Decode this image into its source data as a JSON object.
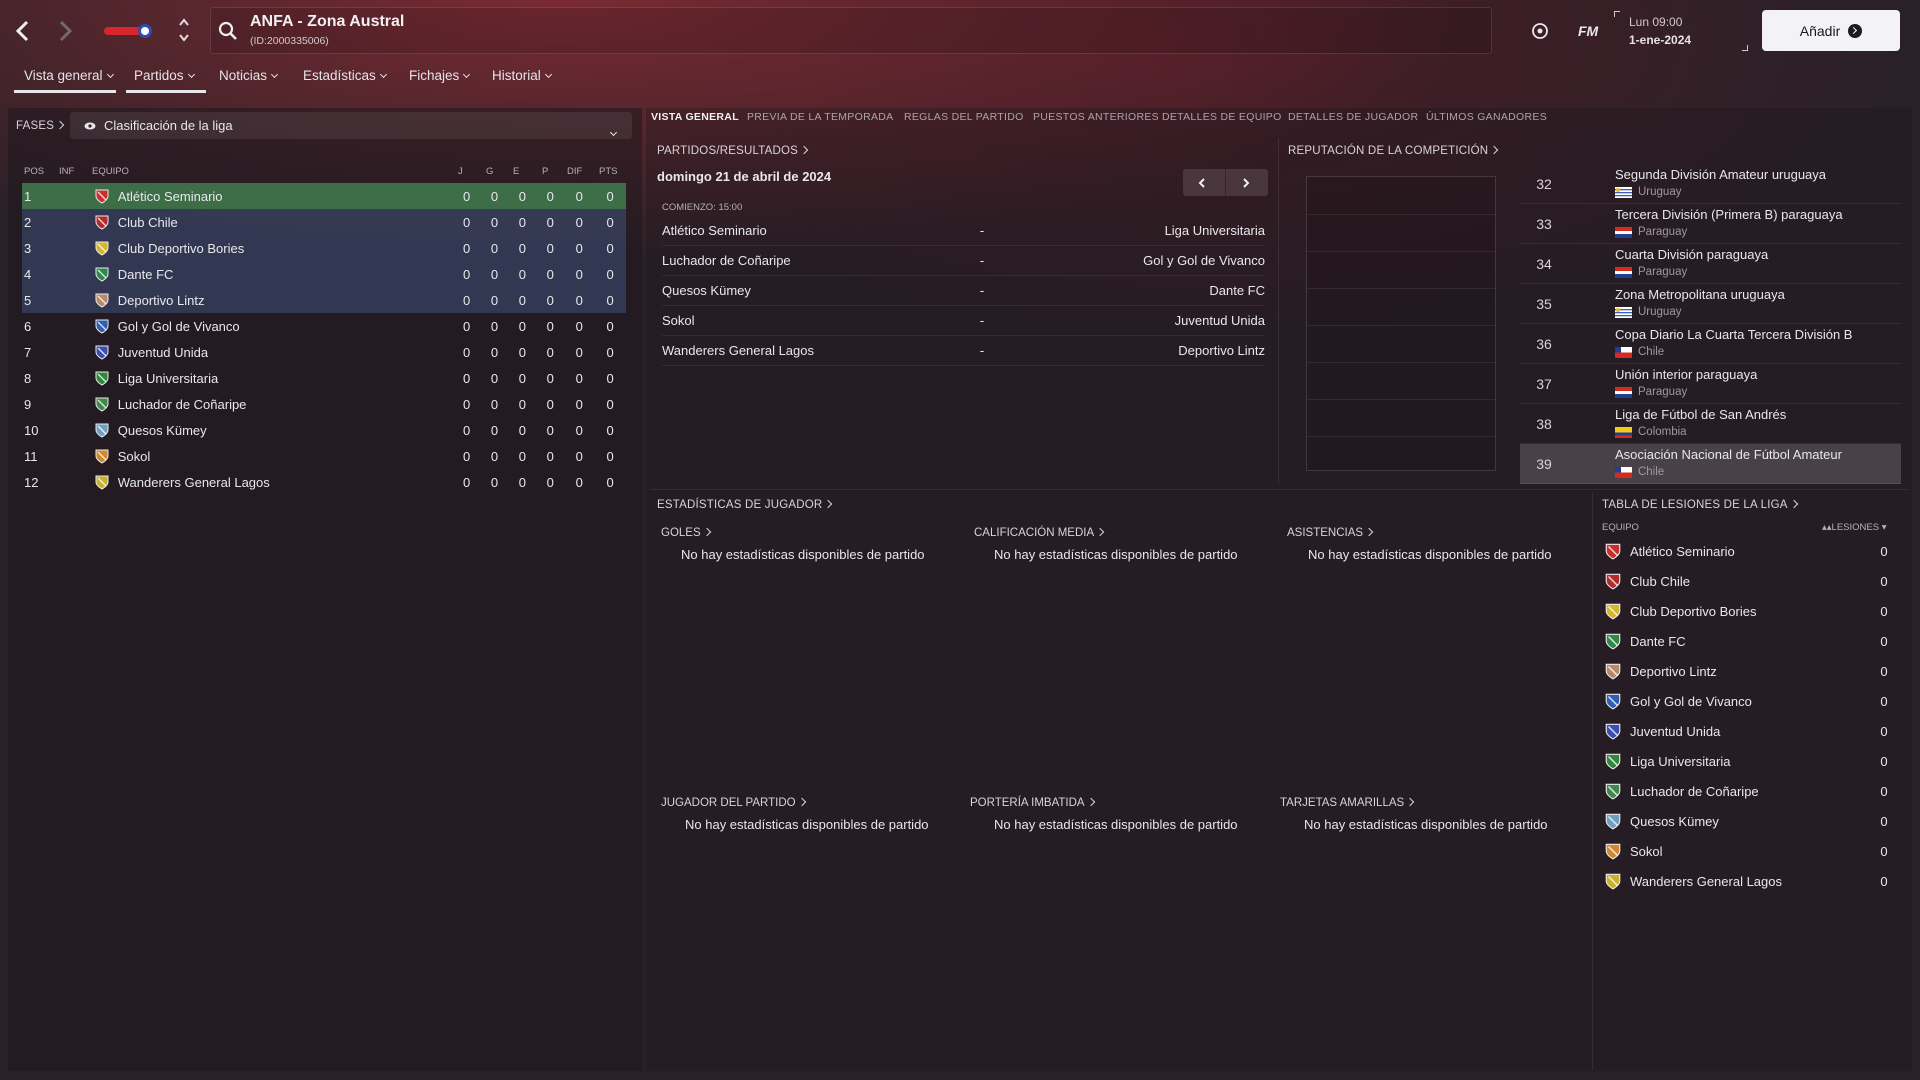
{
  "header": {
    "title": "ANFA - Zona Austral",
    "id": "(ID:2000335006)",
    "fm": "FM",
    "day": "Lun 09:00",
    "date": "1-ene-2024",
    "add_label": "Añadir"
  },
  "nav": [
    {
      "label": "Vista general",
      "active": true
    },
    {
      "label": "Partidos",
      "active": true
    },
    {
      "label": "Noticias",
      "active": false
    },
    {
      "label": "Estadísticas",
      "active": false
    },
    {
      "label": "Fichajes",
      "active": false
    },
    {
      "label": "Historial",
      "active": false
    }
  ],
  "phases": {
    "label": "FASES",
    "select": "Clasificación de la liga"
  },
  "table": {
    "headers": {
      "pos": "POS",
      "inf": "INF",
      "team": "EQUIPO",
      "j": "J",
      "g": "G",
      "e": "E",
      "p": "P",
      "dif": "DIF",
      "pts": "PTS"
    },
    "rows": [
      {
        "pos": "1",
        "team": "Atlético Seminario",
        "stats": [
          "0",
          "0",
          "0",
          "0",
          "0",
          "0"
        ]
      },
      {
        "pos": "2",
        "team": "Club Chile",
        "stats": [
          "0",
          "0",
          "0",
          "0",
          "0",
          "0"
        ]
      },
      {
        "pos": "3",
        "team": "Club Deportivo Bories",
        "stats": [
          "0",
          "0",
          "0",
          "0",
          "0",
          "0"
        ]
      },
      {
        "pos": "4",
        "team": "Dante FC",
        "stats": [
          "0",
          "0",
          "0",
          "0",
          "0",
          "0"
        ]
      },
      {
        "pos": "5",
        "team": "Deportivo Lintz",
        "stats": [
          "0",
          "0",
          "0",
          "0",
          "0",
          "0"
        ]
      },
      {
        "pos": "6",
        "team": "Gol y Gol de Vivanco",
        "stats": [
          "0",
          "0",
          "0",
          "0",
          "0",
          "0"
        ]
      },
      {
        "pos": "7",
        "team": "Juventud Unida",
        "stats": [
          "0",
          "0",
          "0",
          "0",
          "0",
          "0"
        ]
      },
      {
        "pos": "8",
        "team": "Liga Universitaria",
        "stats": [
          "0",
          "0",
          "0",
          "0",
          "0",
          "0"
        ]
      },
      {
        "pos": "9",
        "team": "Luchador de Coñaripe",
        "stats": [
          "0",
          "0",
          "0",
          "0",
          "0",
          "0"
        ]
      },
      {
        "pos": "10",
        "team": "Quesos Kümey",
        "stats": [
          "0",
          "0",
          "0",
          "0",
          "0",
          "0"
        ]
      },
      {
        "pos": "11",
        "team": "Sokol",
        "stats": [
          "0",
          "0",
          "0",
          "0",
          "0",
          "0"
        ]
      },
      {
        "pos": "12",
        "team": "Wanderers General Lagos",
        "stats": [
          "0",
          "0",
          "0",
          "0",
          "0",
          "0"
        ]
      }
    ]
  },
  "tabs": [
    {
      "label": "VISTA GENERAL",
      "active": true
    },
    {
      "label": "PREVIA DE LA TEMPORADA"
    },
    {
      "label": "REGLAS DEL PARTIDO"
    },
    {
      "label": "PUESTOS ANTERIORES"
    },
    {
      "label": "DETALLES DE EQUIPO"
    },
    {
      "label": "DETALLES DE JUGADOR"
    },
    {
      "label": "ÚLTIMOS GANADORES"
    }
  ],
  "fixtures": {
    "title": "PARTIDOS/RESULTADOS",
    "date": "domingo 21 de abril de 2024",
    "kickoff": "COMIENZO: 15:00",
    "matches": [
      {
        "home": "Atlético Seminario",
        "sep": "-",
        "away": "Liga Universitaria"
      },
      {
        "home": "Luchador de Coñaripe",
        "sep": "-",
        "away": "Gol y Gol de Vivanco"
      },
      {
        "home": "Quesos Kümey",
        "sep": "-",
        "away": "Dante FC"
      },
      {
        "home": "Sokol",
        "sep": "-",
        "away": "Juventud Unida"
      },
      {
        "home": "Wanderers General Lagos",
        "sep": "-",
        "away": "Deportivo Lintz"
      }
    ]
  },
  "reputation": {
    "title": "REPUTACIÓN DE LA COMPETICIÓN",
    "items": [
      {
        "rank": "32",
        "name": "Segunda División Amateur uruguaya",
        "country": "Uruguay"
      },
      {
        "rank": "33",
        "name": "Tercera División (Primera B) paraguaya",
        "country": "Paraguay"
      },
      {
        "rank": "34",
        "name": "Cuarta División paraguaya",
        "country": "Paraguay"
      },
      {
        "rank": "35",
        "name": "Zona Metropolitana uruguaya",
        "country": "Uruguay"
      },
      {
        "rank": "36",
        "name": "Copa Diario La Cuarta Tercera División B",
        "country": "Chile"
      },
      {
        "rank": "37",
        "name": "Unión interior paraguaya",
        "country": "Paraguay"
      },
      {
        "rank": "38",
        "name": "Liga de Fútbol de San Andrés",
        "country": "Colombia"
      },
      {
        "rank": "39",
        "name": "Asociación Nacional de Fútbol Amateur",
        "country": "Chile"
      }
    ]
  },
  "player_stats": {
    "title": "ESTADÍSTICAS DE JUGADOR",
    "empty": "No hay estadísticas disponibles de partido",
    "goals": "GOLES",
    "rating": "CALIFICACIÓN MEDIA",
    "assists": "ASISTENCIAS",
    "motm": "JUGADOR DEL PARTIDO",
    "clean": "PORTERÍA IMBATIDA",
    "yellow": "TARJETAS AMARILLAS"
  },
  "injuries": {
    "title": "TABLA DE LESIONES DE LA LIGA",
    "col_team": "EQUIPO",
    "col_inj": "LESIONES",
    "rows": [
      {
        "team": "Atlético Seminario",
        "value": "0"
      },
      {
        "team": "Club Chile",
        "value": "0"
      },
      {
        "team": "Club Deportivo Bories",
        "value": "0"
      },
      {
        "team": "Dante FC",
        "value": "0"
      },
      {
        "team": "Deportivo Lintz",
        "value": "0"
      },
      {
        "team": "Gol y Gol de Vivanco",
        "value": "0"
      },
      {
        "team": "Juventud Unida",
        "value": "0"
      },
      {
        "team": "Liga Universitaria",
        "value": "0"
      },
      {
        "team": "Luchador de Coñaripe",
        "value": "0"
      },
      {
        "team": "Quesos Kümey",
        "value": "0"
      },
      {
        "team": "Sokol",
        "value": "0"
      },
      {
        "team": "Wanderers General Lagos",
        "value": "0"
      }
    ]
  },
  "colors": {
    "green": "#3d6e47",
    "blue": "#4b6296",
    "crest_colors": [
      "#c9302c",
      "#b32b2b",
      "#d4b82c",
      "#2f8a4a",
      "#b98a6a",
      "#2f5fb3",
      "#3a4fb0",
      "#2e8a3a",
      "#3e8a4e",
      "#6fa0c0",
      "#d08a2c",
      "#c8b22c"
    ]
  }
}
